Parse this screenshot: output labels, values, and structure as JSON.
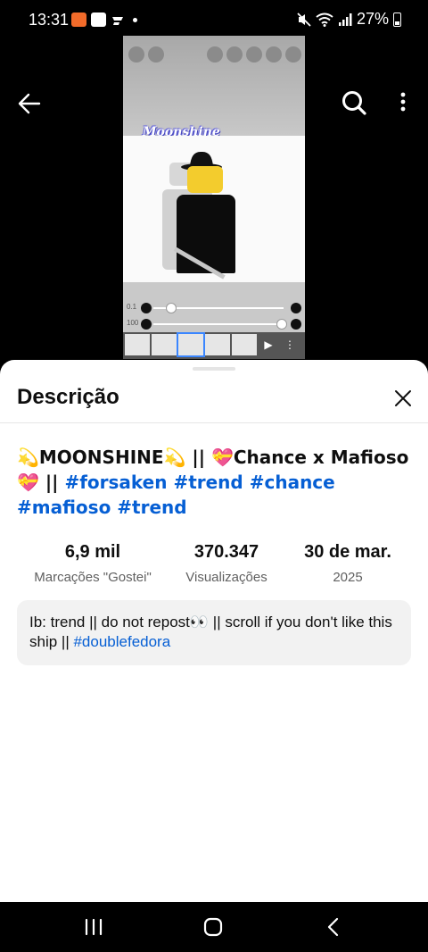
{
  "status_bar": {
    "time": "13:31",
    "battery": "27%"
  },
  "video": {
    "overlay_title": "Moonshine"
  },
  "sheet": {
    "title": "Descrição",
    "video_title": {
      "text": "💫MOONSHINE💫 || 💝Chance x Mafioso 💝 || ",
      "hashtags": [
        "#forsaken",
        "#trend",
        "#chance",
        "#mafioso",
        "#trend"
      ]
    },
    "stats": [
      {
        "value": "6,9 mil",
        "label": "Marcações \"Gostei\""
      },
      {
        "value": "370.347",
        "label": "Visualizações"
      },
      {
        "value": "30 de mar.",
        "label": "2025"
      }
    ],
    "description": {
      "text": "Ib: trend || do not repost👀 || scroll if you don't like this ship || ",
      "hashtag": "#doublefedora"
    }
  },
  "colors": {
    "link": "#065fd4",
    "background": "#ffffff",
    "top_background": "#000000"
  },
  "icons": [
    "back-arrow-icon",
    "search-icon",
    "more-vert-icon",
    "close-icon",
    "recent-apps-icon",
    "home-icon",
    "nav-back-icon"
  ]
}
